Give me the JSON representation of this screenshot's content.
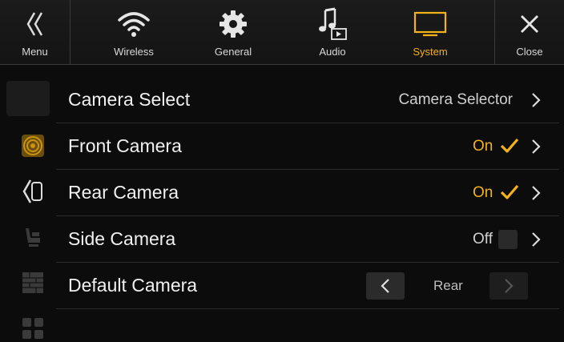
{
  "tabs": [
    {
      "label": "Menu",
      "icon": "double-chevron-left-icon"
    },
    {
      "label": "Wireless",
      "icon": "wifi-icon"
    },
    {
      "label": "General",
      "icon": "gear-icon"
    },
    {
      "label": "Audio",
      "icon": "music-note-icon"
    },
    {
      "label": "System",
      "icon": "tv-screen-icon",
      "active": true
    },
    {
      "label": "Close",
      "icon": "close-icon"
    }
  ],
  "sidebar": {
    "items": [
      "camera-settings-icon",
      "camera-direction-icon",
      "seat-icon",
      "grid-icon",
      "apps-icon"
    ]
  },
  "rows": [
    {
      "title": "Camera Select",
      "value": "Camera Selector"
    },
    {
      "title": "Front Camera",
      "value": "On",
      "checked": true
    },
    {
      "title": "Rear Camera",
      "value": "On",
      "checked": true
    },
    {
      "title": "Side Camera",
      "value": "Off",
      "checked": false
    },
    {
      "title": "Default Camera",
      "value": "Rear"
    }
  ],
  "colors": {
    "accent": "#f2b21a",
    "background": "#0c0c0c",
    "text": "#f0f0f0"
  }
}
